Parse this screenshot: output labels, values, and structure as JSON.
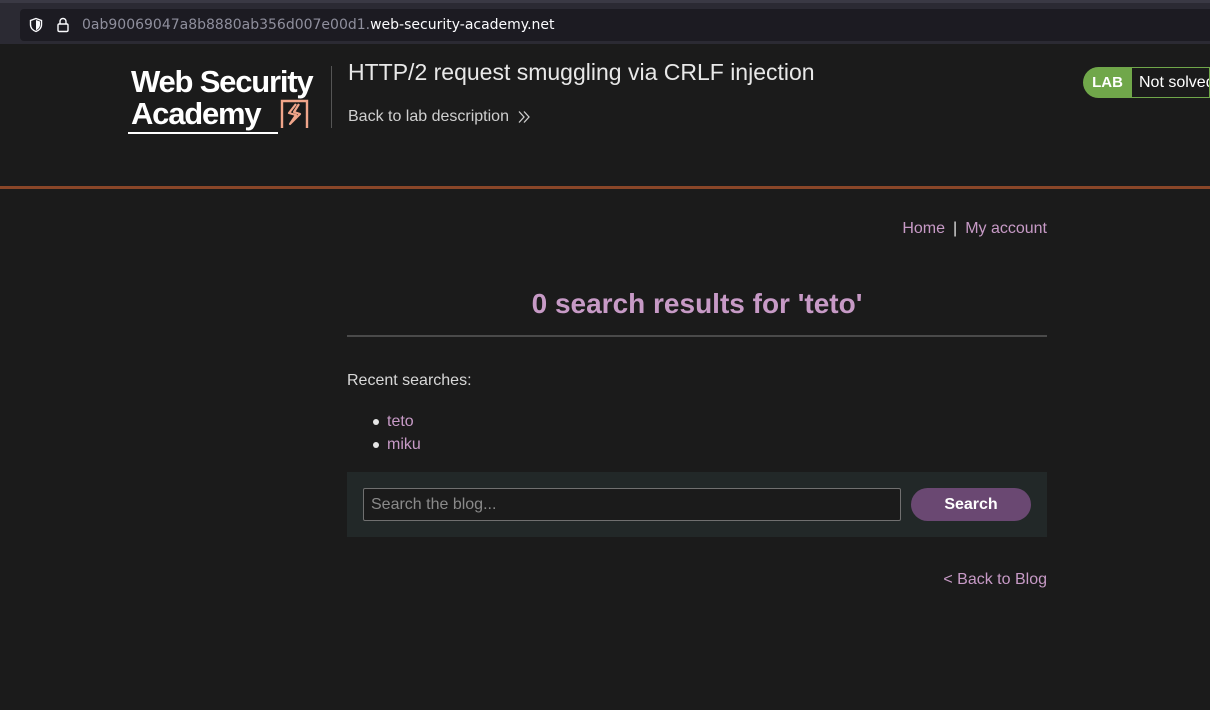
{
  "browser": {
    "url_subdomain": "0ab90069047a8b8880ab356d007e00d1.",
    "url_domain": "web-security-academy.net"
  },
  "header": {
    "logo_line1": "Web Security",
    "logo_line2": "Academy",
    "lab_title": "HTTP/2 request smuggling via CRLF injection",
    "back_to_lab": "Back to lab description",
    "lab_badge": "LAB",
    "lab_status": "Not solved"
  },
  "nav": {
    "home": "Home",
    "separator": "|",
    "my_account": "My account"
  },
  "main": {
    "results_title": "0 search results for 'teto'",
    "recent_label": "Recent searches:",
    "recent_searches": [
      "teto",
      "miku"
    ],
    "search_placeholder": "Search the blog...",
    "search_button": "Search",
    "back_to_blog": "< Back to Blog"
  },
  "colors": {
    "accent_link": "#c79ac6",
    "lab_green": "#70a74a",
    "header_rule": "#8a4628",
    "logo_mark": "#f0a58a",
    "button": "#6a4872"
  },
  "icons": [
    "shield-icon",
    "lock-icon",
    "chevrons-right-icon",
    "logo-mark-icon"
  ]
}
